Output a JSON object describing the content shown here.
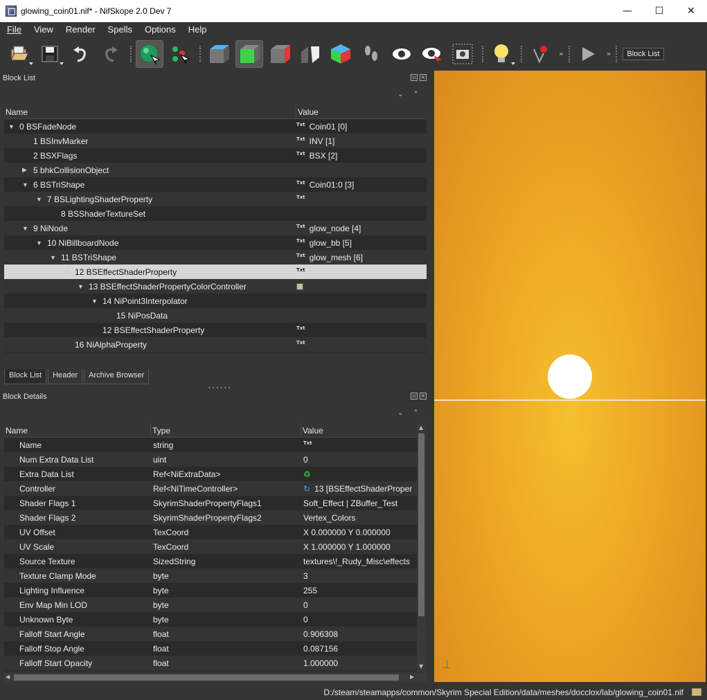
{
  "window": {
    "title": "glowing_coin01.nif* - NifSkope 2.0 Dev 7",
    "minimize": "—",
    "maximize": "☐",
    "close": "✕"
  },
  "menu": [
    "File",
    "View",
    "Render",
    "Spells",
    "Options",
    "Help"
  ],
  "toolbar": {
    "block_list_label": "Block List",
    "more": "»"
  },
  "block_list": {
    "title": "Block List",
    "col_name": "Name",
    "col_value": "Value",
    "rows": [
      {
        "indent": 0,
        "arrow": "down",
        "name": "0 BSFadeNode",
        "icon": "Txt",
        "value": "Coin01 [0]"
      },
      {
        "indent": 1,
        "arrow": "",
        "name": "1 BSInvMarker",
        "icon": "Txt",
        "value": "INV [1]"
      },
      {
        "indent": 1,
        "arrow": "",
        "name": "2 BSXFlags",
        "icon": "Txt",
        "value": "BSX [2]"
      },
      {
        "indent": 1,
        "arrow": "right",
        "name": "5 bhkCollisionObject",
        "icon": "",
        "value": ""
      },
      {
        "indent": 1,
        "arrow": "down",
        "name": "6 BSTriShape",
        "icon": "Txt",
        "value": "Coin01:0 [3]"
      },
      {
        "indent": 2,
        "arrow": "down",
        "name": "7 BSLightingShaderProperty",
        "icon": "Txt",
        "value": ""
      },
      {
        "indent": 3,
        "arrow": "",
        "name": "8 BSShaderTextureSet",
        "icon": "",
        "value": ""
      },
      {
        "indent": 1,
        "arrow": "down",
        "name": "9 NiNode",
        "icon": "Txt",
        "value": "glow_node [4]"
      },
      {
        "indent": 2,
        "arrow": "down",
        "name": "10 NiBillboardNode",
        "icon": "Txt",
        "value": "glow_bb [5]"
      },
      {
        "indent": 3,
        "arrow": "down",
        "name": "11 BSTriShape",
        "icon": "Txt",
        "value": "glow_mesh [6]"
      },
      {
        "indent": 4,
        "arrow": "down",
        "name": "12 BSEffectShaderProperty",
        "icon": "Txt",
        "value": "",
        "selected": true
      },
      {
        "indent": 5,
        "arrow": "down",
        "name": "13 BSEffectShaderPropertyColorController",
        "icon": "ctrl",
        "value": ""
      },
      {
        "indent": 6,
        "arrow": "down",
        "name": "14 NiPoint3Interpolator",
        "icon": "",
        "value": ""
      },
      {
        "indent": 7,
        "arrow": "",
        "name": "15 NiPosData",
        "icon": "",
        "value": ""
      },
      {
        "indent": 6,
        "arrow": "",
        "name": "12 BSEffectShaderProperty",
        "icon": "Txt",
        "value": ""
      },
      {
        "indent": 4,
        "arrow": "",
        "name": "16 NiAlphaProperty",
        "icon": "Txt",
        "value": ""
      }
    ]
  },
  "tabs": [
    "Block List",
    "Header",
    "Archive Browser"
  ],
  "block_details": {
    "title": "Block Details",
    "col_name": "Name",
    "col_type": "Type",
    "col_value": "Value",
    "rows": [
      {
        "name": "Name",
        "type": "string",
        "icon": "Txt",
        "value": ""
      },
      {
        "name": "Num Extra Data List",
        "type": "uint",
        "icon": "",
        "value": "0"
      },
      {
        "name": "Extra Data List",
        "type": "Ref<NiExtraData>",
        "icon": "refresh",
        "value": ""
      },
      {
        "name": "Controller",
        "type": "Ref<NiTimeController>",
        "icon": "link",
        "value": "13 [BSEffectShaderProper"
      },
      {
        "name": "Shader Flags 1",
        "type": "SkyrimShaderPropertyFlags1",
        "icon": "",
        "value": "Soft_Effect | ZBuffer_Test"
      },
      {
        "name": "Shader Flags 2",
        "type": "SkyrimShaderPropertyFlags2",
        "icon": "",
        "value": "Vertex_Colors"
      },
      {
        "name": "UV Offset",
        "type": "TexCoord",
        "icon": "",
        "value": "X 0.000000 Y 0.000000"
      },
      {
        "name": "UV Scale",
        "type": "TexCoord",
        "icon": "",
        "value": "X 1.000000 Y 1.000000"
      },
      {
        "name": "Source Texture",
        "type": "SizedString",
        "icon": "",
        "value": "textures\\!_Rudy_Misc\\effects"
      },
      {
        "name": "Texture Clamp Mode",
        "type": "byte",
        "icon": "",
        "value": "3"
      },
      {
        "name": "Lighting Influence",
        "type": "byte",
        "icon": "",
        "value": "255"
      },
      {
        "name": "Env Map Min LOD",
        "type": "byte",
        "icon": "",
        "value": "0"
      },
      {
        "name": "Unknown Byte",
        "type": "byte",
        "icon": "",
        "value": "0"
      },
      {
        "name": "Falloff Start Angle",
        "type": "float",
        "icon": "",
        "value": "0.906308"
      },
      {
        "name": "Falloff Stop Angle",
        "type": "float",
        "icon": "",
        "value": "0.087156"
      },
      {
        "name": "Falloff Start Opacity",
        "type": "float",
        "icon": "",
        "value": "1.000000"
      }
    ]
  },
  "status": {
    "path": "D:/steam/steamapps/common/Skyrim Special Edition/data/meshes/docclox/lab/glowing_coin01.nif"
  },
  "colors": {
    "viewport_bg": "#eda624",
    "selected_row": "#d6d6d6",
    "window_bg": "#353535"
  }
}
